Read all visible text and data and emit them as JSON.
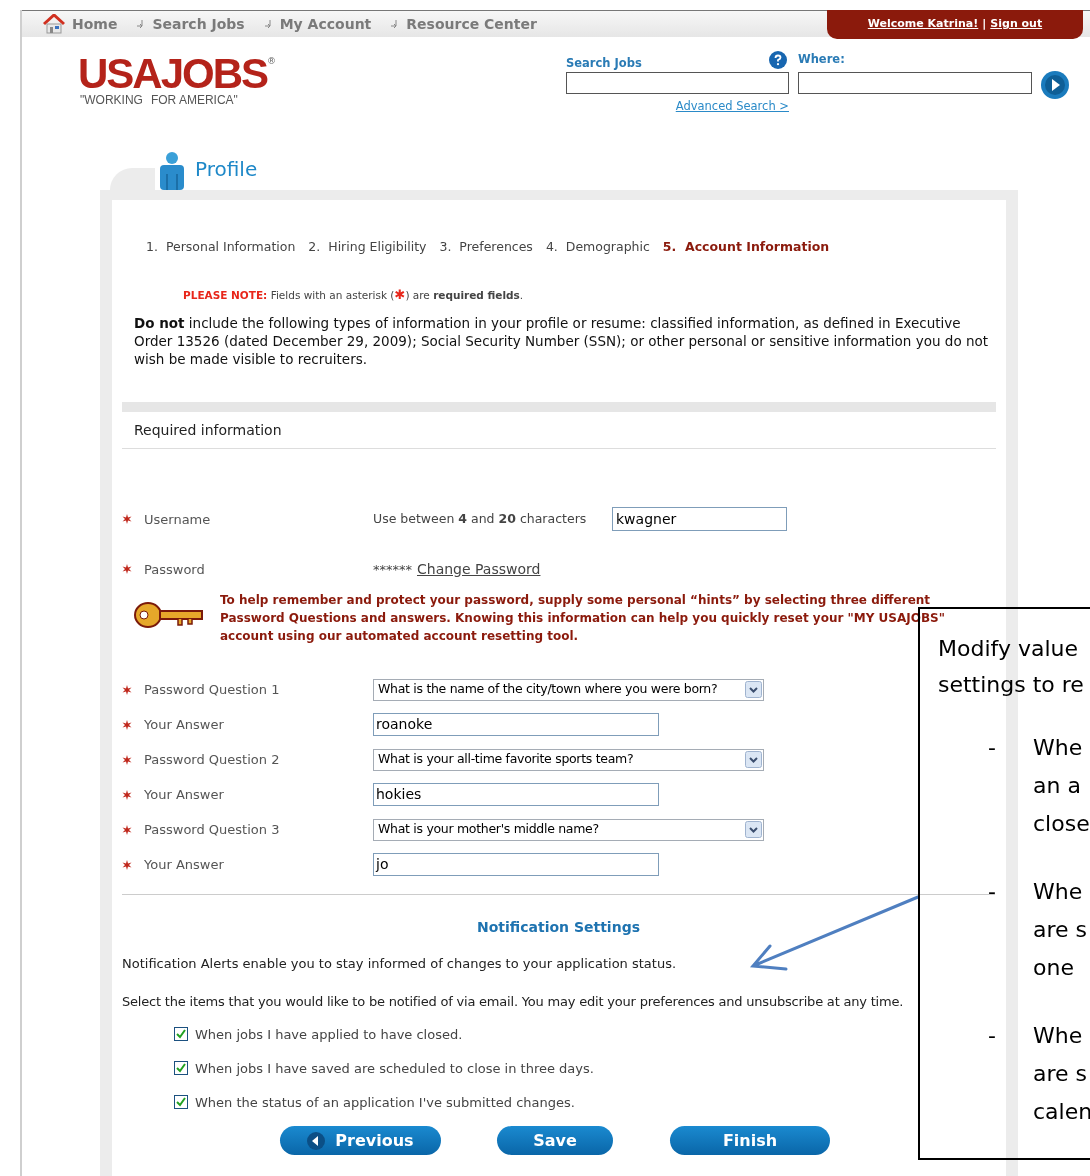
{
  "nav": {
    "items": [
      {
        "label": "Home",
        "kind": "home"
      },
      {
        "label": "Search Jobs",
        "kind": "link"
      },
      {
        "label": "My Account",
        "kind": "link"
      },
      {
        "label": "Resource Center",
        "kind": "link"
      }
    ],
    "welcome": "Welcome Katrina!",
    "separator": "|",
    "signout": "Sign out"
  },
  "logo": {
    "main": "USAJOBS",
    "mark": "®",
    "tagline_left": "\"WORKING",
    "tagline_right": "FOR AMERICA\""
  },
  "search": {
    "jobs_label": "Search Jobs",
    "where_label": "Where:",
    "advanced": "Advanced Search >"
  },
  "profile_title": "Profile",
  "steps": [
    {
      "number": "1.",
      "label": "Personal Information",
      "selected": false
    },
    {
      "number": "2.",
      "label": "Hiring Eligibility",
      "selected": false
    },
    {
      "number": "3.",
      "label": "Preferences",
      "selected": false
    },
    {
      "number": "4.",
      "label": "Demographic",
      "selected": false
    },
    {
      "number": "5.",
      "label": "Account Information",
      "selected": true
    }
  ],
  "note": {
    "label": "PLEASE NOTE:",
    "text_before": "Fields with an asterisk (",
    "asterisk": "✱",
    "text_after": ") are **required fields**."
  },
  "warning": "**Do not** include the following types of information in your profile or resume: classified information, as defined in Executive Order 13526 (dated December 29, 2009); Social Security Number (SSN); or other personal or sensitive information you do not wish be made visible to recruiters.",
  "section_title": "Required information",
  "username": {
    "label": "Username",
    "hint": "Use between **4** and **20** characters",
    "value": "kwagner"
  },
  "password": {
    "label": "Password",
    "mask": "******",
    "link": "Change Password"
  },
  "hint_text": "To help remember and protect your password, supply some personal “hints” by selecting three different Password Questions and answers. Knowing this information can help you quickly reset your \"MY USAJOBS\" account using our automated account resetting tool.",
  "questions": [
    {
      "label": "Password Question 1",
      "question": "What is the name of the city/town where you were born?",
      "answer_label": "Your Answer",
      "answer": "roanoke"
    },
    {
      "label": "Password Question 2",
      "question": "What is your all-time favorite sports team?",
      "answer_label": "Your Answer",
      "answer": "hokies"
    },
    {
      "label": "Password Question 3",
      "question": "What is your mother's middle name?",
      "answer_label": "Your Answer",
      "answer": "jo"
    }
  ],
  "notifications": {
    "title": "Notification Settings",
    "intro": "Notification Alerts enable you to stay informed of changes to your application status.",
    "instructions": "Select the items that you would like to be notified of via email. You may edit your preferences and unsubscribe at any time.",
    "options": [
      {
        "label": "When jobs I have applied to have closed.",
        "checked": true
      },
      {
        "label": "When jobs I have saved are scheduled to close in three days.",
        "checked": true
      },
      {
        "label": "When the status of an application I've submitted changes.",
        "checked": true
      }
    ]
  },
  "buttons": [
    {
      "label": "Previous",
      "kind": "back"
    },
    {
      "label": "Save",
      "kind": "plain"
    },
    {
      "label": "Finish",
      "kind": "plain"
    }
  ],
  "callout": {
    "lines": [
      "Modify value",
      "settings to re"
    ],
    "bullets": [
      {
        "dash": "-",
        "lines": [
          "Whe",
          "an a",
          "close"
        ]
      },
      {
        "dash": "-",
        "lines": [
          "Whe",
          "are s",
          "one"
        ]
      },
      {
        "dash": "-",
        "lines": [
          "Whe",
          "are s",
          "calen"
        ]
      }
    ]
  }
}
